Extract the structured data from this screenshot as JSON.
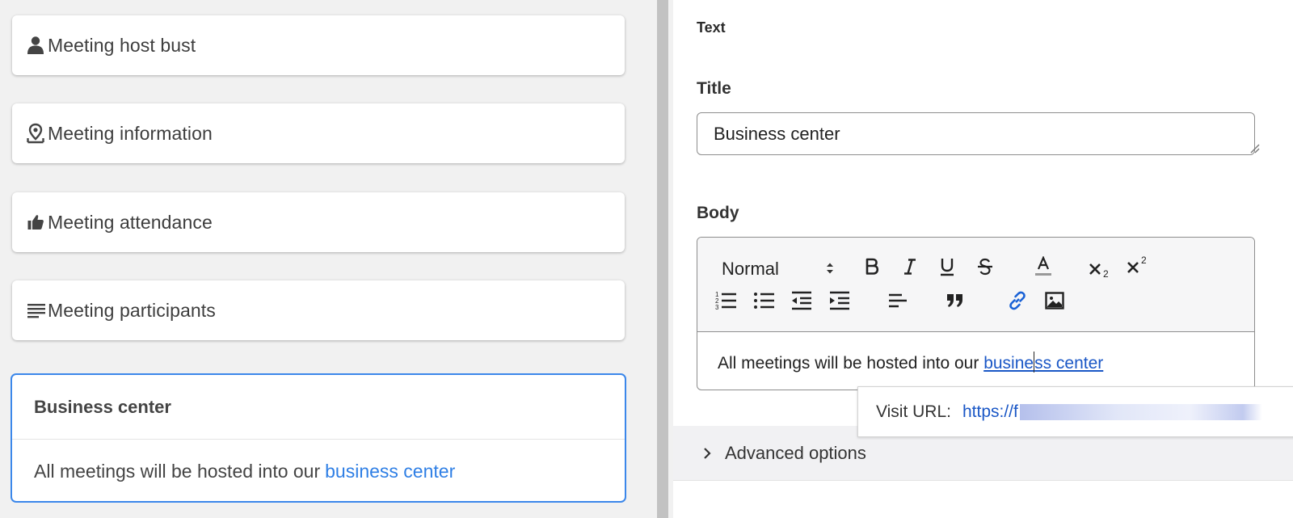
{
  "left": {
    "cards": [
      {
        "label": "Meeting host bust",
        "icon": "person-icon"
      },
      {
        "label": "Meeting information",
        "icon": "map-pin-icon"
      },
      {
        "label": "Meeting attendance",
        "icon": "thumbs-up-icon"
      },
      {
        "label": "Meeting participants",
        "icon": "text-lines-icon"
      }
    ],
    "selected_card": {
      "title": "Business center",
      "body_text": "All meetings will be hosted into our",
      "body_link": "business center"
    }
  },
  "right": {
    "section_label": "Text",
    "title_label": "Title",
    "title_value": "Business center",
    "body_label": "Body",
    "editor": {
      "format_select": "Normal",
      "content_text": "All meetings will be hosted into our",
      "content_link_before_caret": "busine",
      "content_link_after_caret": "ss center"
    },
    "url_tooltip": {
      "label": "Visit URL:",
      "value": "https://f"
    },
    "advanced_options_label": "Advanced options"
  },
  "colors": {
    "accent": "#3b87ea",
    "link": "#2f7fe5",
    "editor_link": "#1a57c6",
    "left_bg": "#f1f1f1"
  }
}
